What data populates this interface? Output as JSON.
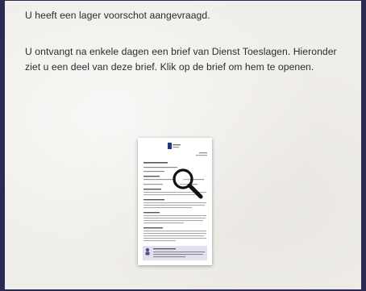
{
  "content": {
    "paragraph_1": "U heeft een lager voorschot aangevraagd.",
    "paragraph_2": "U ontvangt na enkele dagen een brief van Dienst Toeslagen. Hieronder ziet u een deel van deze brief. Klik op de brief om hem te openen."
  },
  "letter": {
    "icon": "magnifier-icon",
    "callout_color": "#e4dff0",
    "logo_color": "#1f3a7a"
  },
  "colors": {
    "frame": "#2b2a52",
    "panel": "#f0eeea",
    "text": "#2c2c2c"
  }
}
